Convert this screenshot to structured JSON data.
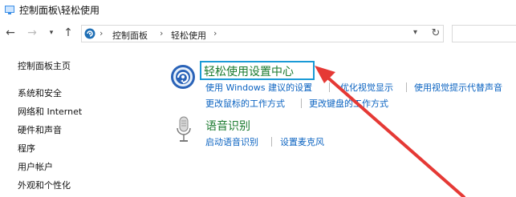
{
  "window": {
    "title": "控制面板\\轻松使用"
  },
  "navigation": {
    "back_icon": "back-arrow-icon",
    "forward_icon": "forward-arrow-icon",
    "recent_icon": "chevron-down-icon",
    "up_icon": "up-arrow-icon",
    "breadcrumb": [
      "控制面板",
      "轻松使用"
    ],
    "refresh_icon": "refresh-icon",
    "search_placeholder": ""
  },
  "sidebar": {
    "items": [
      {
        "label": "控制面板主页"
      },
      {
        "label": "系统和安全"
      },
      {
        "label": "网络和 Internet"
      },
      {
        "label": "硬件和声音"
      },
      {
        "label": "程序"
      },
      {
        "label": "用户帐户"
      },
      {
        "label": "外观和个性化"
      }
    ]
  },
  "main": {
    "ease_center": {
      "title": "轻松使用设置中心",
      "links_row1": [
        "使用 Windows 建议的设置",
        "优化视觉显示",
        "使用视觉提示代替声音"
      ],
      "links_row2": [
        "更改鼠标的工作方式",
        "更改键盘的工作方式"
      ]
    },
    "speech": {
      "title": "语音识别",
      "links": [
        "启动语音识别",
        "设置麦克风"
      ]
    }
  },
  "colors": {
    "link": "#0b63c1",
    "section_title": "#1a7a2e",
    "highlight": "#1a9ad6",
    "annotation_arrow": "#e53935"
  }
}
